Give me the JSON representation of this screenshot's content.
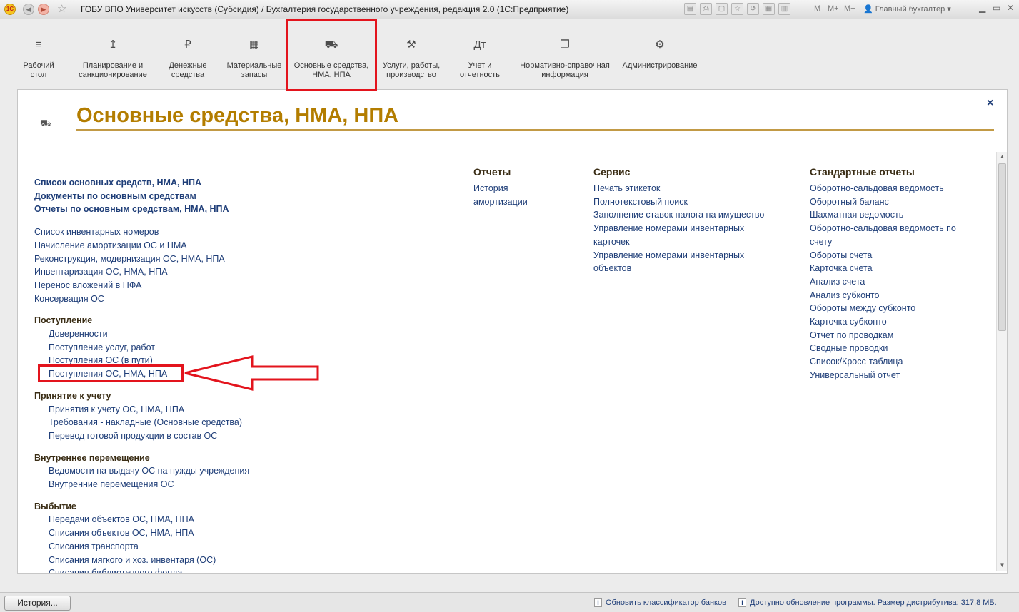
{
  "window": {
    "title": "ГОБУ ВПО Университет искусств (Субсидия) / Бухгалтерия государственного учреждения, редакция 2.0  (1С:Предприятие)",
    "logo_text": "1С",
    "user": "Главный бухгалтер",
    "m_buttons": [
      "M",
      "M+",
      "M−"
    ]
  },
  "sections": [
    {
      "icon": "menu-icon",
      "glyph": "≡",
      "label": "Рабочий\nстол"
    },
    {
      "icon": "planning-icon",
      "glyph": "↥",
      "label": "Планирование и\nсанкционирование"
    },
    {
      "icon": "money-icon",
      "glyph": "₽",
      "label": "Денежные\nсредства"
    },
    {
      "icon": "materials-icon",
      "glyph": "▦",
      "label": "Материальные\nзапасы"
    },
    {
      "icon": "truck-icon",
      "glyph": "⛟",
      "label": "Основные средства,\nНМА, НПА"
    },
    {
      "icon": "tools-icon",
      "glyph": "⚒",
      "label": "Услуги, работы,\nпроизводство"
    },
    {
      "icon": "accounting-icon",
      "glyph": "Дт",
      "label": "Учет и\nотчетность"
    },
    {
      "icon": "reference-icon",
      "glyph": "❐",
      "label": "Нормативно-справочная\nинформация"
    },
    {
      "icon": "gear-icon",
      "glyph": "⚙",
      "label": "Администрирование"
    }
  ],
  "page": {
    "title": "Основные средства, НМА, НПА",
    "close_glyph": "×"
  },
  "main_links_bold": [
    "Список основных средств, НМА, НПА",
    "Документы по основным средствам",
    "Отчеты по основным средствам, НМА, НПА"
  ],
  "main_links": [
    "Список инвентарных номеров",
    "Начисление амортизации ОС и НМА",
    "Реконструкция, модернизация ОС, НМА, НПА",
    "Инвентаризация ОС, НМА, НПА",
    "Перенос вложений в НФА",
    "Консервация ОС"
  ],
  "groups": [
    {
      "title": "Поступление",
      "items": [
        "Доверенности",
        "Поступление услуг, работ",
        "Поступления ОС (в пути)",
        "Поступления ОС, НМА, НПА"
      ]
    },
    {
      "title": "Принятие к учету",
      "items": [
        "Принятия к учету ОС, НМА, НПА",
        "Требования - накладные (Основные средства)",
        "Перевод готовой продукции в состав ОС"
      ]
    },
    {
      "title": "Внутреннее перемещение",
      "items": [
        "Ведомости на выдачу ОС на нужды учреждения",
        "Внутренние перемещения ОС"
      ]
    },
    {
      "title": "Выбытие",
      "items": [
        "Передачи объектов ОС, НМА, НПА",
        "Списания объектов ОС, НМА, НПА",
        "Списания транспорта",
        "Списания мягкого и хоз. инвентаря (ОС)",
        "Списания библиотечного фонда"
      ]
    }
  ],
  "reports": {
    "title": "Отчеты",
    "items": [
      "История",
      "амортизации"
    ]
  },
  "service": {
    "title": "Сервис",
    "items": [
      "Печать этикеток",
      "Полнотекстовый поиск",
      "Заполнение ставок налога на имущество",
      "Управление номерами инвентарных",
      "карточек",
      "Управление номерами инвентарных",
      "объектов"
    ]
  },
  "std_reports": {
    "title": "Стандартные отчеты",
    "items": [
      "Оборотно-сальдовая ведомость",
      "Оборотный баланс",
      "Шахматная ведомость",
      "Оборотно-сальдовая ведомость по",
      "счету",
      "Обороты счета",
      "Карточка счета",
      "Анализ счета",
      "Анализ субконто",
      "Обороты между субконто",
      "Карточка субконто",
      "Отчет по проводкам",
      "Сводные проводки",
      "Список/Кросс-таблица",
      "Универсальный отчет"
    ]
  },
  "statusbar": {
    "history_button": "История...",
    "info1": "Обновить классификатор банков",
    "info2": "Доступно обновление программы. Размер дистрибутива: 317,8 МБ."
  },
  "colors": {
    "link": "#1f3e78",
    "title": "#b37d00",
    "annotation_red": "#e3141d"
  }
}
